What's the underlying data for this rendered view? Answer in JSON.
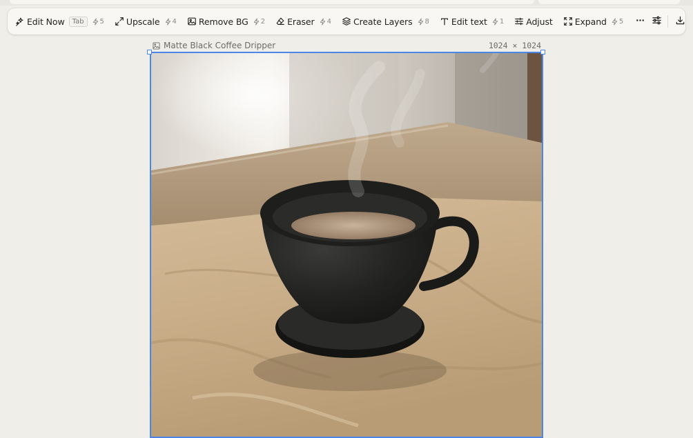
{
  "toolbar": {
    "tools": [
      {
        "label": "Edit Now",
        "shortcut": "Tab",
        "credits": "5",
        "icon": "sparkles-icon"
      },
      {
        "label": "Upscale",
        "credits": "4",
        "icon": "expand-arrows-icon"
      },
      {
        "label": "Remove BG",
        "credits": "2",
        "icon": "image-icon"
      },
      {
        "label": "Eraser",
        "credits": "4",
        "icon": "eraser-icon"
      },
      {
        "label": "Create Layers",
        "credits": "8",
        "icon": "layers-icon"
      },
      {
        "label": "Edit text",
        "credits": "1",
        "icon": "text-icon"
      },
      {
        "label": "Adjust",
        "icon": "sliders-icon"
      },
      {
        "label": "Expand",
        "credits": "5",
        "icon": "expand-frame-icon"
      }
    ],
    "more_icon": "more-horizontal-icon",
    "settings_icon": "settings-sliders-icon",
    "download_icon": "download-icon"
  },
  "image": {
    "name": "Matte Black Coffee Dripper",
    "dimensions": "1024 × 1024",
    "icon": "image-icon"
  },
  "colors": {
    "accent": "#4a86e8",
    "background": "#f0eee9",
    "toolbar": "#f8f7f4"
  }
}
